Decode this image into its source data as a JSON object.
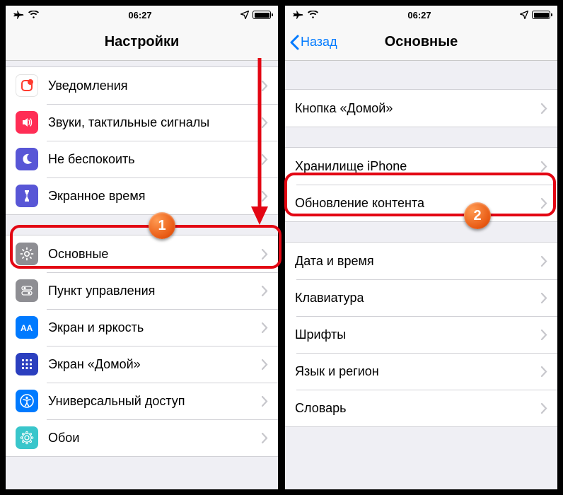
{
  "statusbar": {
    "time": "06:27"
  },
  "left": {
    "title": "Настройки",
    "group1": [
      {
        "icon": "notifications",
        "bg": "#ff3b30",
        "label": "Уведомления"
      },
      {
        "icon": "sounds",
        "bg": "#ff2d55",
        "label": "Звуки, тактильные сигналы"
      },
      {
        "icon": "dnd",
        "bg": "#5856d6",
        "label": "Не беспокоить"
      },
      {
        "icon": "screentime",
        "bg": "#5856d6",
        "label": "Экранное время"
      }
    ],
    "group2": [
      {
        "icon": "general",
        "bg": "#8e8e93",
        "label": "Основные"
      },
      {
        "icon": "control",
        "bg": "#8e8e93",
        "label": "Пункт управления"
      },
      {
        "icon": "display",
        "bg": "#007aff",
        "label": "Экран и яркость"
      },
      {
        "icon": "home",
        "bg": "#3355dd",
        "label": "Экран «Домой»"
      },
      {
        "icon": "accessibility",
        "bg": "#007aff",
        "label": "Универсальный доступ"
      },
      {
        "icon": "wallpaper",
        "bg": "#34c2c7",
        "label": "Обои"
      }
    ]
  },
  "right": {
    "back": "Назад",
    "title": "Основные",
    "group1": [
      {
        "label": "Кнопка «Домой»"
      }
    ],
    "group2": [
      {
        "label": "Хранилище iPhone"
      },
      {
        "label": "Обновление контента"
      }
    ],
    "group3": [
      {
        "label": "Дата и время"
      },
      {
        "label": "Клавиатура"
      },
      {
        "label": "Шрифты"
      },
      {
        "label": "Язык и регион"
      },
      {
        "label": "Словарь"
      }
    ]
  },
  "annotations": {
    "badge1": "1",
    "badge2": "2"
  }
}
